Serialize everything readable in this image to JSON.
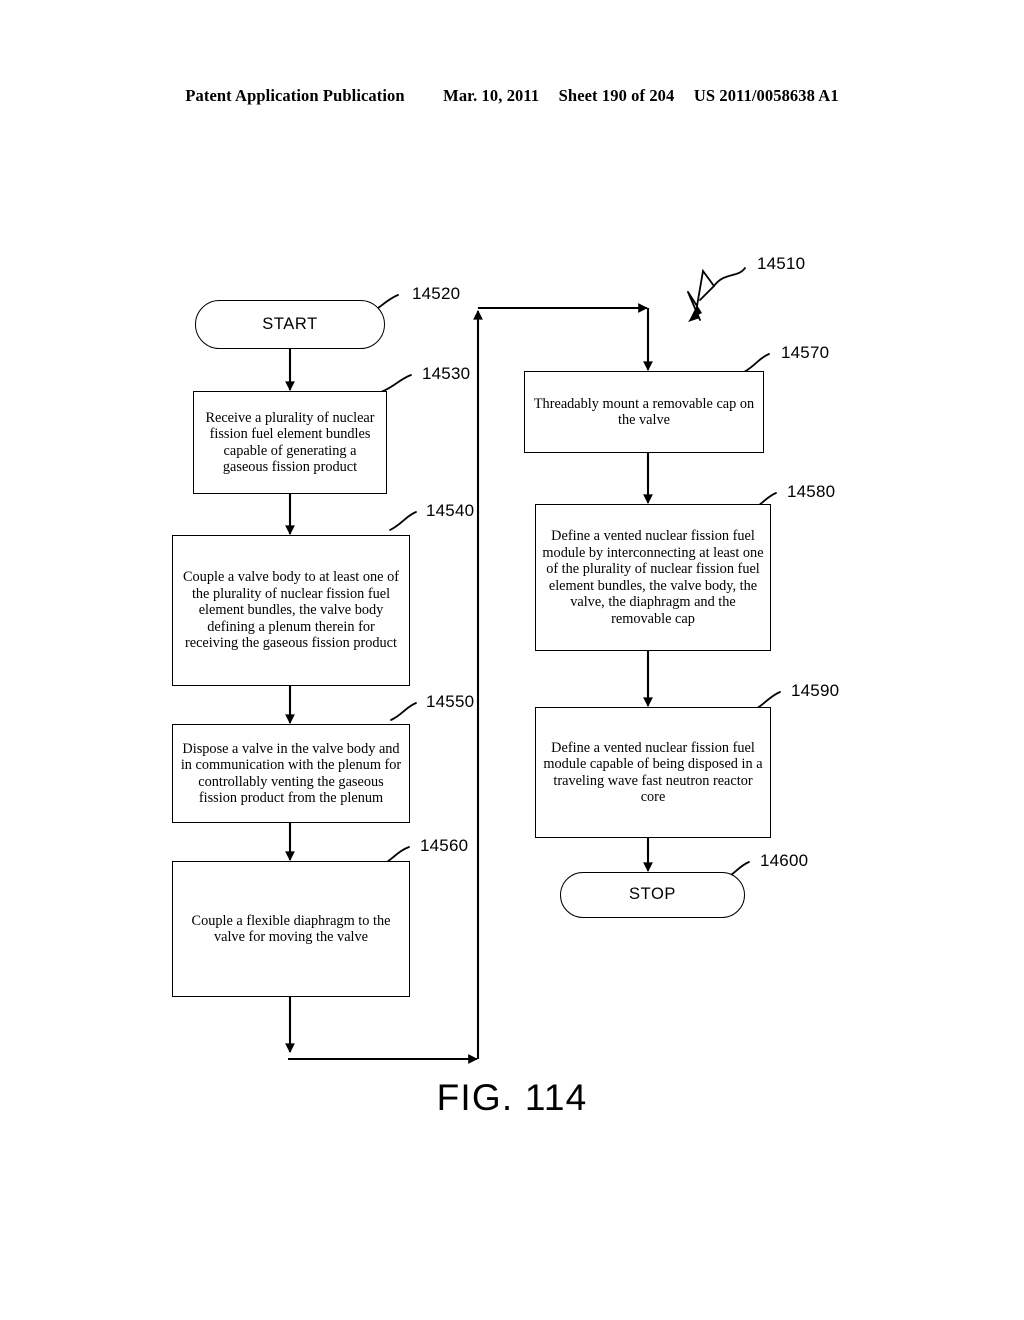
{
  "header": {
    "publication": "Patent Application Publication",
    "date": "Mar. 10, 2011",
    "sheet": "Sheet 190 of 204",
    "patent_number": "US 2011/0058638 A1"
  },
  "figure": {
    "caption": "FIG. 114",
    "diagram_ref": "14510"
  },
  "nodes": [
    {
      "id": "start",
      "ref": "14520",
      "label": "START",
      "shape": "terminal"
    },
    {
      "id": "n14530",
      "ref": "14530",
      "label": "Receive a plurality of nuclear fission fuel element bundles capable of generating a gaseous fission product",
      "shape": "process"
    },
    {
      "id": "n14540",
      "ref": "14540",
      "label": "Couple a valve body to at least one of the plurality of nuclear fission fuel element bundles, the valve body defining a plenum therein for receiving the gaseous fission product",
      "shape": "process"
    },
    {
      "id": "n14550",
      "ref": "14550",
      "label": "Dispose a valve in the valve body and in communication with the plenum for controllably venting the gaseous fission product from the plenum",
      "shape": "process"
    },
    {
      "id": "n14560",
      "ref": "14560",
      "label": "Couple a flexible diaphragm to the valve for moving the valve",
      "shape": "process"
    },
    {
      "id": "n14570",
      "ref": "14570",
      "label": "Threadably mount a removable cap on the valve",
      "shape": "process"
    },
    {
      "id": "n14580",
      "ref": "14580",
      "label": "Define a vented nuclear fission fuel module by interconnecting at least one of the plurality of nuclear fission fuel element bundles, the valve body, the valve, the diaphragm and the removable cap",
      "shape": "process"
    },
    {
      "id": "n14590",
      "ref": "14590",
      "label": "Define a vented nuclear fission fuel module capable of being disposed in a traveling wave fast neutron reactor core",
      "shape": "process"
    },
    {
      "id": "stop",
      "ref": "14600",
      "label": "STOP",
      "shape": "terminal"
    }
  ],
  "colors": {
    "line": "#000000",
    "background": "#ffffff"
  }
}
